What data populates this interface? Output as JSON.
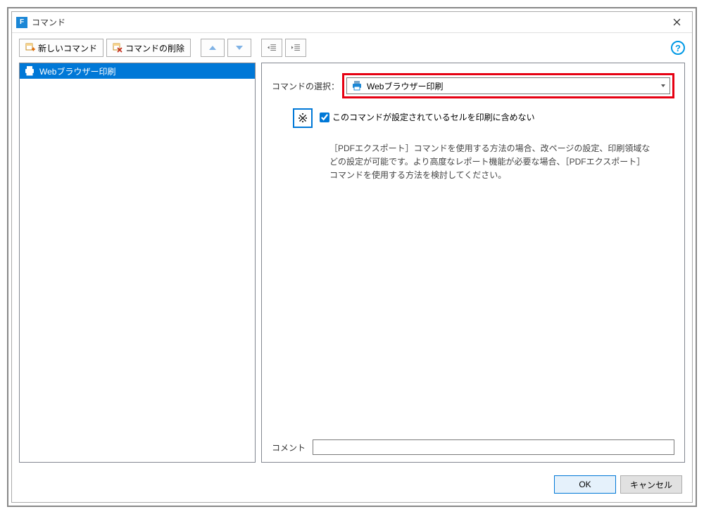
{
  "window": {
    "app_icon_letter": "F",
    "title": "コマンド"
  },
  "toolbar": {
    "new_command": "新しいコマンド",
    "delete_command": "コマンドの削除"
  },
  "list": {
    "items": [
      {
        "label": "Webブラウザー印刷"
      }
    ]
  },
  "right": {
    "select_label": "コマンドの選択：",
    "select_value": "Webブラウザー印刷",
    "ref_mark": "※",
    "checkbox_label": "このコマンドが設定されているセルを印刷に含めない",
    "checkbox_checked": true,
    "info_text": "［PDFエクスポート］コマンドを使用する方法の場合、改ページの設定、印刷領域などの設定が可能です。より高度なレポート機能が必要な場合、［PDFエクスポート］コマンドを使用する方法を検討してください。",
    "comment_label": "コメント",
    "comment_value": ""
  },
  "footer": {
    "ok": "OK",
    "cancel": "キャンセル"
  },
  "help": "?"
}
